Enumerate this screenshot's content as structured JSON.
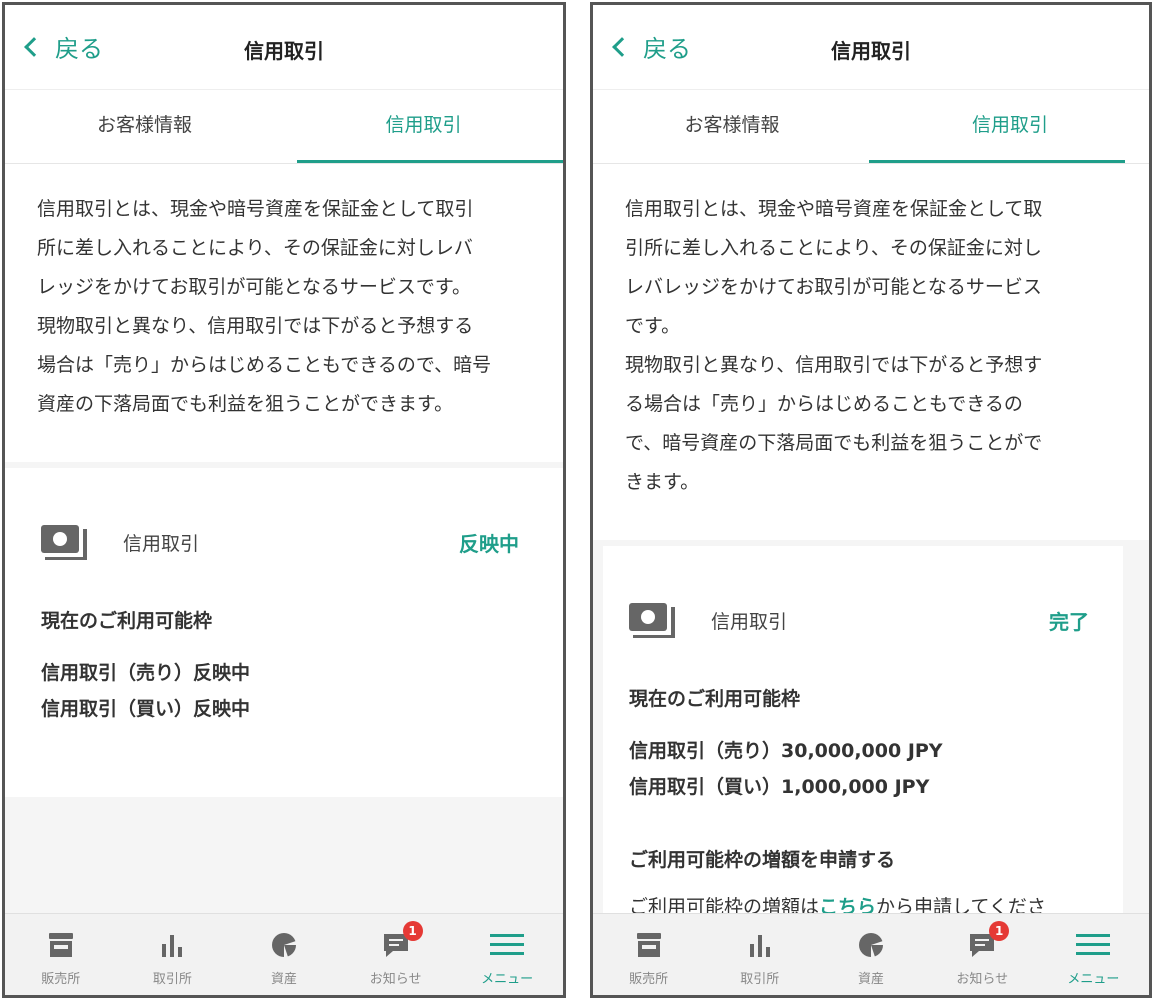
{
  "colors": {
    "accent": "#1f9e8a",
    "badge": "#e53935",
    "icon_gray": "#666666"
  },
  "left": {
    "header": {
      "back_label": "戻る",
      "title": "信用取引"
    },
    "tabs": [
      {
        "label": "お客様情報"
      },
      {
        "label": "信用取引"
      }
    ],
    "description": [
      "信用取引とは、現金や暗号資産を保証金として取引",
      "所に差し入れることにより、その保証金に対しレバ",
      "レッジをかけてお取引が可能となるサービスです。",
      "現物取引と異なり、信用取引では下がると予想する",
      "場合は「売り」からはじめることもできるので、暗号",
      "資産の下落局面でも利益を狙うことができます。"
    ],
    "status": {
      "label": "信用取引",
      "value": "反映中"
    },
    "limit": {
      "title": "現在のご利用可能枠",
      "sell": "信用取引（売り）反映中",
      "buy": "信用取引（買い）反映中"
    }
  },
  "right": {
    "header": {
      "back_label": "戻る",
      "title": "信用取引"
    },
    "tabs": [
      {
        "label": "お客様情報"
      },
      {
        "label": "信用取引"
      }
    ],
    "description": [
      "信用取引とは、現金や暗号資産を保証金として取",
      "引所に差し入れることにより、その保証金に対し",
      "レバレッジをかけてお取引が可能となるサービス",
      "です。",
      "現物取引と異なり、信用取引では下がると予想す",
      "る場合は「売り」からはじめることもできるの",
      "で、暗号資産の下落局面でも利益を狙うことがで",
      "きます。"
    ],
    "status": {
      "label": "信用取引",
      "value": "完了"
    },
    "limit": {
      "title": "現在のご利用可能枠",
      "sell": "信用取引（売り）30,000,000 JPY",
      "buy": "信用取引（買い）1,000,000 JPY"
    },
    "increase": {
      "title": "ご利用可能枠の増額を申請する",
      "text_before": "ご利用可能枠の増額は",
      "link": "こちら",
      "text_after": "から申請してくださ"
    }
  },
  "nav": [
    {
      "label": "販売所",
      "icon": "store-icon"
    },
    {
      "label": "取引所",
      "icon": "bar-chart-icon"
    },
    {
      "label": "資産",
      "icon": "pie-chart-icon"
    },
    {
      "label": "お知らせ",
      "icon": "message-icon",
      "badge": "1"
    },
    {
      "label": "メニュー",
      "icon": "hamburger-menu-icon",
      "active": true
    }
  ]
}
